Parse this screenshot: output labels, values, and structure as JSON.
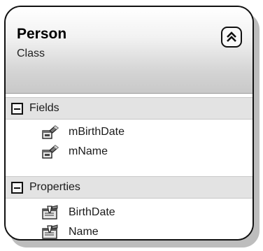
{
  "class_box": {
    "name": "Person",
    "kind": "Class",
    "collapse_icon": "chevron-double-up-icon"
  },
  "sections": {
    "fields": {
      "label": "Fields",
      "toggle_icon": "minus-box-icon",
      "items": [
        {
          "name": "mBirthDate",
          "icon": "field-icon"
        },
        {
          "name": "mName",
          "icon": "field-icon"
        }
      ]
    },
    "properties": {
      "label": "Properties",
      "toggle_icon": "minus-box-icon",
      "items": [
        {
          "name": "BirthDate",
          "icon": "property-icon"
        },
        {
          "name": "Name",
          "icon": "property-icon"
        }
      ]
    }
  }
}
